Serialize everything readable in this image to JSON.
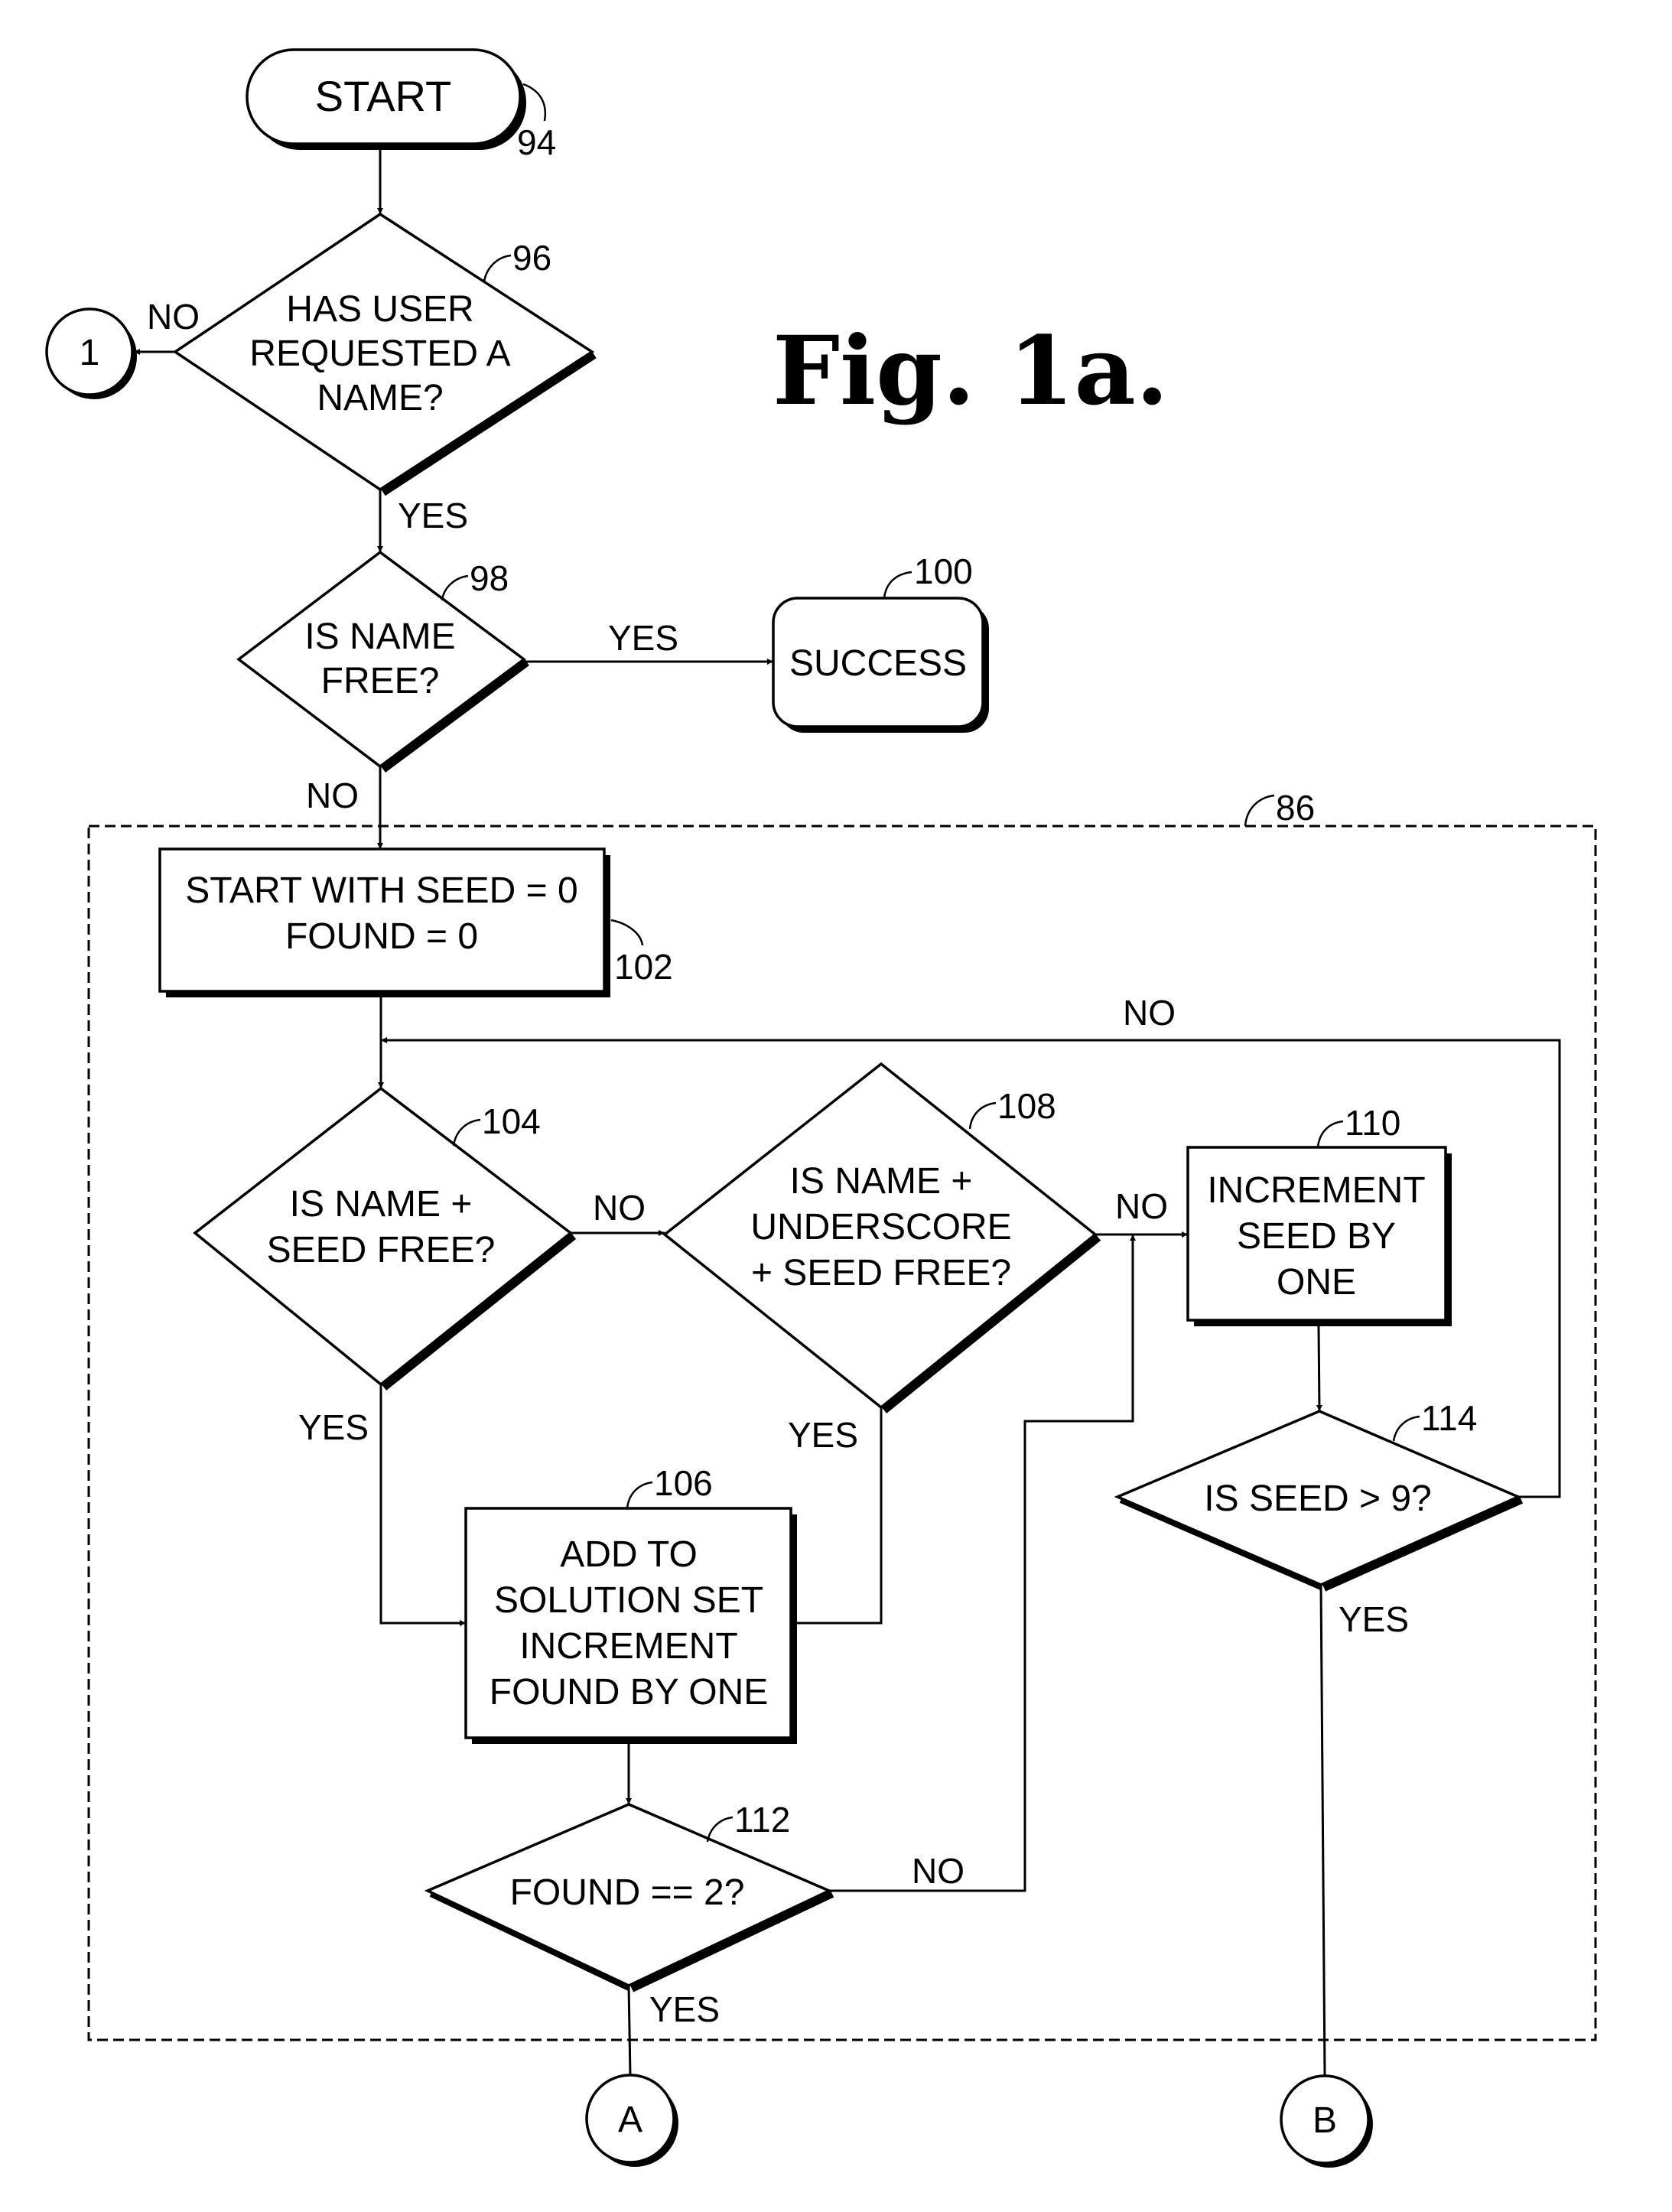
{
  "figure": {
    "title": "Fig. 1a.",
    "group_ref": "86"
  },
  "nodes": {
    "start": {
      "ref": "94",
      "lines": [
        "START"
      ]
    },
    "q96": {
      "ref": "96",
      "lines": [
        "HAS USER",
        "REQUESTED A",
        "NAME?"
      ]
    },
    "conn1": {
      "lines": [
        "1"
      ]
    },
    "q98": {
      "ref": "98",
      "lines": [
        "IS NAME",
        "FREE?"
      ]
    },
    "success": {
      "ref": "100",
      "lines": [
        "SUCCESS"
      ]
    },
    "b102": {
      "ref": "102",
      "lines": [
        "START WITH SEED = 0",
        "FOUND = 0"
      ]
    },
    "q104": {
      "ref": "104",
      "lines": [
        "IS NAME +",
        "SEED FREE?"
      ]
    },
    "q108": {
      "ref": "108",
      "lines": [
        "IS NAME +",
        "UNDERSCORE",
        "+ SEED FREE?"
      ]
    },
    "b110": {
      "ref": "110",
      "lines": [
        "INCREMENT",
        "SEED BY",
        "ONE"
      ]
    },
    "b106": {
      "ref": "106",
      "lines": [
        "ADD TO",
        "SOLUTION SET",
        "INCREMENT",
        "FOUND BY ONE"
      ]
    },
    "q112": {
      "ref": "112",
      "lines": [
        "FOUND == 2?"
      ]
    },
    "q114": {
      "ref": "114",
      "lines": [
        "IS SEED > 9?"
      ]
    },
    "connA": {
      "lines": [
        "A"
      ]
    },
    "connB": {
      "lines": [
        "B"
      ]
    }
  },
  "edges": {
    "q96_no": "NO",
    "q96_yes": "YES",
    "q98_yes": "YES",
    "q98_no": "NO",
    "loop_no": "NO",
    "q104_no": "NO",
    "q104_yes": "YES",
    "q108_no": "NO",
    "q108_yes": "YES",
    "q112_no": "NO",
    "q112_yes": "YES",
    "q114_yes": "YES"
  }
}
